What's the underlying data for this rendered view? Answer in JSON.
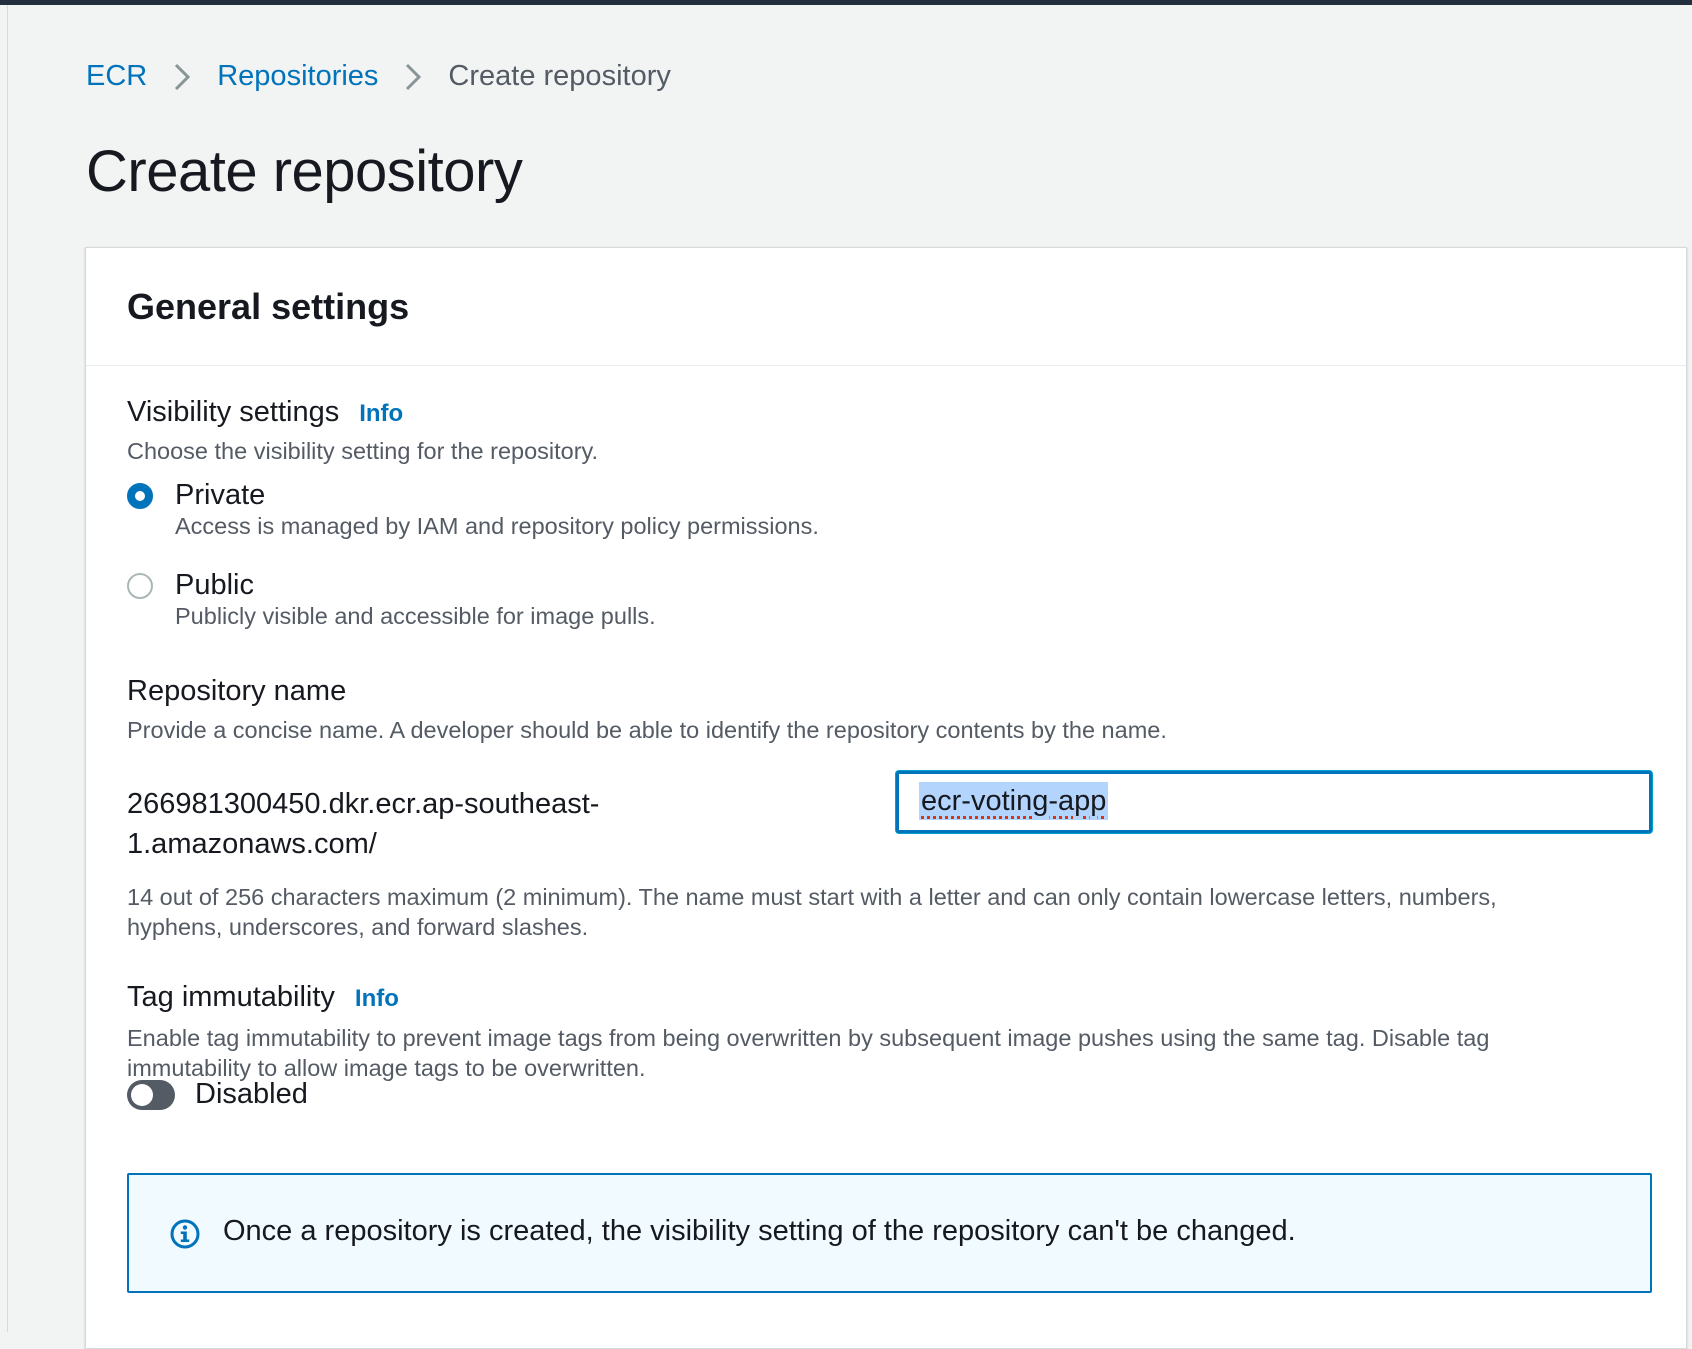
{
  "breadcrumb": {
    "items": [
      {
        "label": "ECR"
      },
      {
        "label": "Repositories"
      },
      {
        "label": "Create repository"
      }
    ]
  },
  "page": {
    "title": "Create repository"
  },
  "panel": {
    "title": "General settings"
  },
  "visibility": {
    "label": "Visibility settings",
    "info": "Info",
    "description": "Choose the visibility setting for the repository.",
    "options": [
      {
        "label": "Private",
        "description": "Access is managed by IAM and repository policy permissions.",
        "selected": true
      },
      {
        "label": "Public",
        "description": "Publicly visible and accessible for image pulls.",
        "selected": false
      }
    ]
  },
  "repository_name": {
    "label": "Repository name",
    "description": "Provide a concise name. A developer should be able to identify the repository contents by the name.",
    "prefix_line1": "266981300450.dkr.ecr.ap-southeast-",
    "prefix_line2": "1.amazonaws.com/",
    "value": "ecr-voting-app",
    "constraint_line1": "14 out of 256 characters maximum (2 minimum). The name must start with a letter and can only contain lowercase letters, numbers,",
    "constraint_line2": "hyphens, underscores, and forward slashes."
  },
  "tag_immutability": {
    "label": "Tag immutability",
    "info": "Info",
    "description_line1": "Enable tag immutability to prevent image tags from being overwritten by subsequent image pushes using the same tag. Disable tag",
    "description_line2": "immutability to allow image tags to be overwritten.",
    "state_label": "Disabled",
    "enabled": false
  },
  "alert": {
    "icon": "info-circle-icon",
    "text": "Once a repository is created, the visibility setting of the repository can't be changed."
  },
  "colors": {
    "link": "#0073bb",
    "background": "#f2f3f3",
    "panel": "#ffffff",
    "alert_background": "#f1faff",
    "toggle_off": "#545b64"
  }
}
